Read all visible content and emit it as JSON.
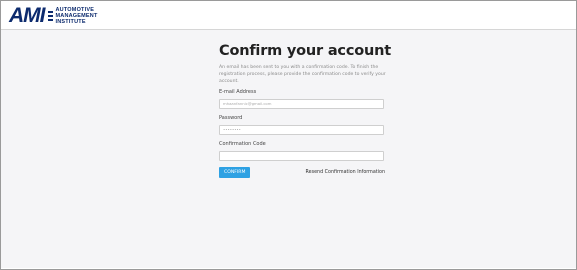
{
  "logo": {
    "mark": "AMI",
    "lines": [
      "AUTOMOTIVE",
      "MANAGEMENT",
      "INSTITUTE"
    ]
  },
  "page": {
    "title": "Confirm your account",
    "description": "An email has been sent to you with a confirmation code. To finish the registration process, please provide the confirmation code to verify your account."
  },
  "form": {
    "email_label": "E-mail Address",
    "email_value": "mhaanfannic@gmail.com",
    "password_label": "Password",
    "password_value": "••••••••",
    "code_label": "Confirmation Code",
    "code_value": "",
    "confirm_label": "CONFIRM",
    "resend_label": "Resend Confirmation Information"
  },
  "colors": {
    "brand": "#0d2b6e",
    "accent": "#2ea1e3",
    "page_bg": "#f5f5f7"
  }
}
